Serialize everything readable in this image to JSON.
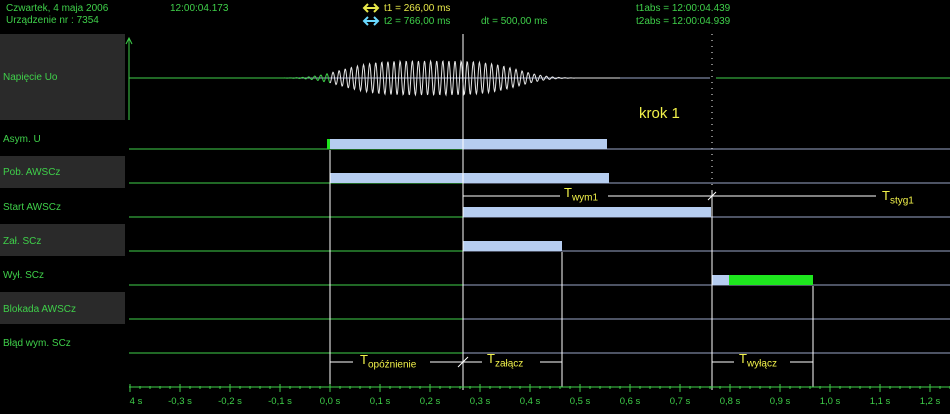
{
  "header": {
    "date": "Czwartek,  4  maja  2006",
    "device": "Urządzenie nr :  7354",
    "time": "12:00:04.173",
    "t1": "t1 = 266,00 ms",
    "t2": "t2 = 766,00 ms",
    "dt": "dt = 500,00 ms",
    "t1abs": "t1abs = 12:00:04.439",
    "t2abs": "t2abs = 12:00:04.939",
    "t1_color": "#e8e84a",
    "t2_color": "#6ad9ff"
  },
  "channels": [
    {
      "name": "Napięcie Uo"
    },
    {
      "name": "Asym. U"
    },
    {
      "name": "Pob. AWSCz"
    },
    {
      "name": "Start AWSCz"
    },
    {
      "name": "Zał. SCz"
    },
    {
      "name": "Wył. SCz"
    },
    {
      "name": "Blokada AWSCz"
    },
    {
      "name": "Błąd wym. SCz"
    }
  ],
  "annotations": {
    "step": "krok 1",
    "t_wym_main": "T",
    "t_wym_sub": "wym1",
    "t_styg_main": "T",
    "t_styg_sub": "styg1",
    "t_opoz_main": "T",
    "t_opoz_sub": "opóźnienie",
    "t_zal_main": "T",
    "t_zal_sub": "załącz",
    "t_wyl_main": "T",
    "t_wyl_sub": "wyłącz"
  },
  "axis": {
    "ticks": [
      "4 s",
      "-0,3 s",
      "-0,2 s",
      "-0,1 s",
      "0,0 s",
      "0,1 s",
      "0,2 s",
      "0,3 s",
      "0,4 s",
      "0,5 s",
      "0,6 s",
      "0,7 s",
      "0,8 s",
      "0,9 s",
      "1,0 s",
      "1,1 s",
      "1,2 s"
    ]
  },
  "colors": {
    "grid_green": "#3fd04a",
    "bar_blue": "#b6cdf0",
    "bar_green": "#1ee61e",
    "annotation": "#f2f24a",
    "label_band": "#2a2a2a"
  }
}
